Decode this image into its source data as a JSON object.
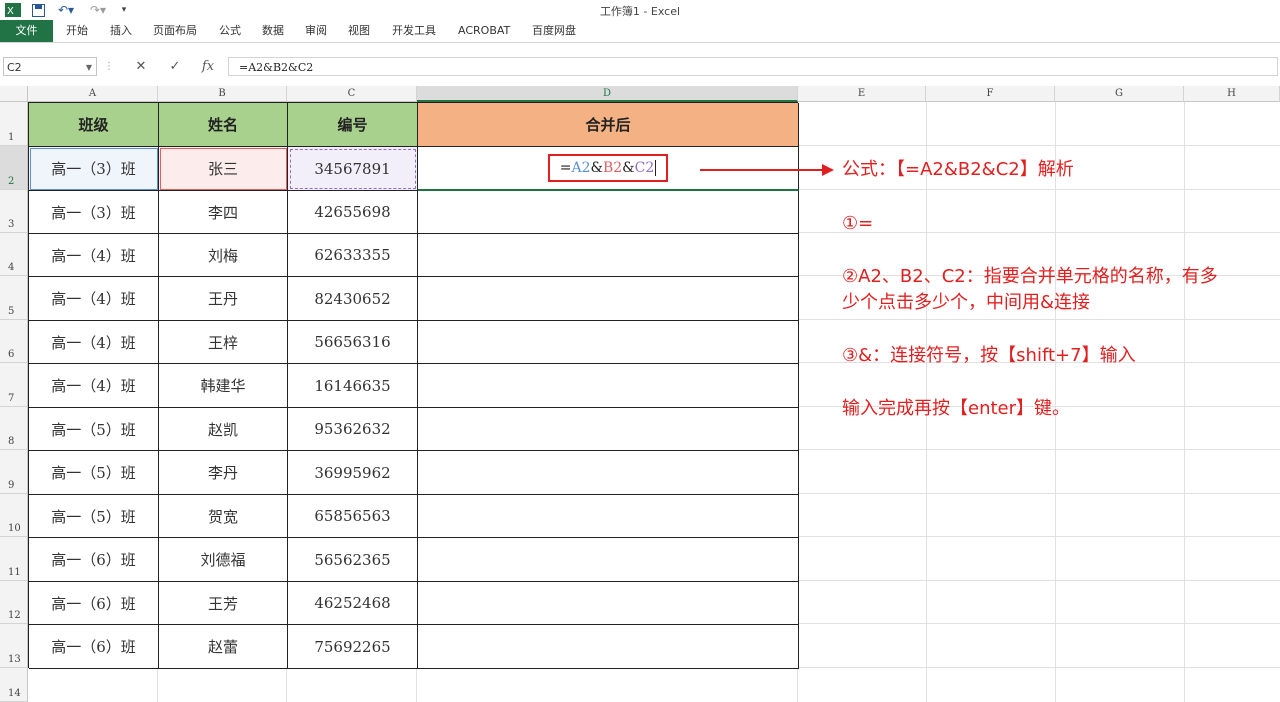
{
  "window": {
    "title": "工作簿1 - Excel"
  },
  "quick_access": {
    "excel_icon": "excel-logo-icon",
    "save_icon": "save-icon",
    "undo_icon": "undo-icon",
    "redo_icon": "redo-icon",
    "dropdown": "▾"
  },
  "ribbon": {
    "tabs": [
      "文件",
      "开始",
      "插入",
      "页面布局",
      "公式",
      "数据",
      "审阅",
      "视图",
      "开发工具",
      "ACROBAT",
      "百度网盘"
    ],
    "file_color": "#217346"
  },
  "formula_bar": {
    "name_box": "C2",
    "cancel": "✕",
    "enter": "✓",
    "fx": "fx",
    "formula": "=A2&B2&C2"
  },
  "sheet": {
    "columns": [
      "A",
      "B",
      "C",
      "D",
      "E",
      "F",
      "G",
      "H"
    ],
    "rows": [
      "1",
      "2",
      "3",
      "4",
      "5",
      "6",
      "7",
      "8",
      "9",
      "10",
      "11",
      "12",
      "13",
      "14"
    ],
    "header_row": [
      "班级",
      "姓名",
      "编号",
      "合并后"
    ],
    "data": [
      [
        "高一（3）班",
        "张三",
        "34567891"
      ],
      [
        "高一（3）班",
        "李四",
        "42655698"
      ],
      [
        "高一（4）班",
        "刘梅",
        "62633355"
      ],
      [
        "高一（4）班",
        "王丹",
        "82430652"
      ],
      [
        "高一（4）班",
        "王梓",
        "56656316"
      ],
      [
        "高一（4）班",
        "韩建华",
        "16146635"
      ],
      [
        "高一（5）班",
        "赵凯",
        "95362632"
      ],
      [
        "高一（5）班",
        "李丹",
        "36995962"
      ],
      [
        "高一（5）班",
        "贺宽",
        "65856563"
      ],
      [
        "高一（6）班",
        "刘德福",
        "56562365"
      ],
      [
        "高一（6）班",
        "王芳",
        "46252468"
      ],
      [
        "高一（6）班",
        "赵蕾",
        "75692265"
      ]
    ],
    "editing_formula": {
      "eq": "=",
      "a": "A2",
      "amp1": "&",
      "b": "B2",
      "amp2": "&",
      "c": "C2"
    },
    "colors": {
      "header_green": "#a9d18e",
      "header_orange": "#f4b183",
      "ref_blue": "#5b8fd6",
      "ref_red": "#e06060",
      "ref_purple": "#8e6fc0"
    }
  },
  "annotations": {
    "color": "#e02020",
    "lines": [
      "公式：【=A2&B2&C2】解析",
      "①=",
      "②A2、B2、C2：指要合并单元格的名称，有多",
      "少个点击多少个，中间用&连接",
      "③&：连接符号，按【shift+7】输入",
      "输入完成再按【enter】键。"
    ]
  }
}
